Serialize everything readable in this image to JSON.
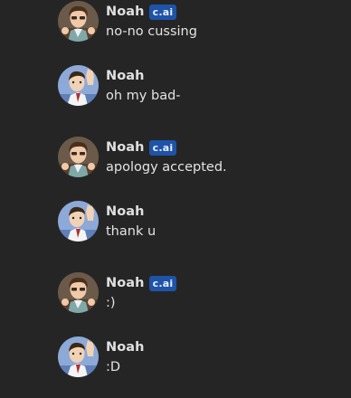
{
  "messages": [
    {
      "sender": "Noah",
      "badge": "c.ai",
      "text": "no-no cussing"
    },
    {
      "sender": "Noah",
      "badge": "",
      "text": "oh my bad-"
    },
    {
      "sender": "Noah",
      "badge": "c.ai",
      "text": "apology accepted."
    },
    {
      "sender": "Noah",
      "badge": "",
      "text": "thank u"
    },
    {
      "sender": "Noah",
      "badge": "c.ai",
      "text": ":)"
    },
    {
      "sender": "Noah",
      "badge": "",
      "text": ":D"
    }
  ],
  "colors": {
    "background": "#252525",
    "badge": "#1e53a8",
    "name": "#e0e0e0",
    "text": "#e3e3e3"
  }
}
